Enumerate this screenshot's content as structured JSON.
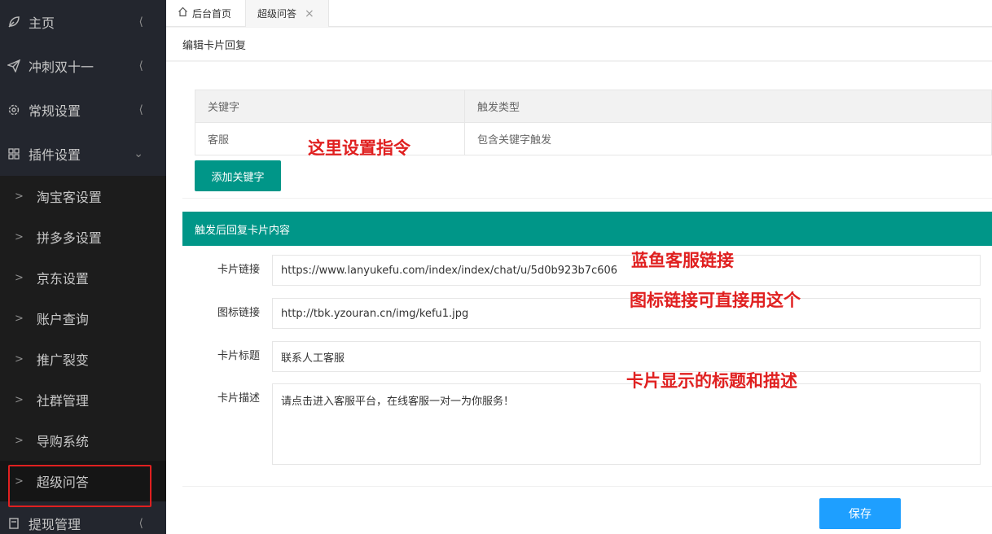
{
  "sidebar": {
    "items": [
      {
        "label": "主页",
        "icon": "leaf-icon"
      },
      {
        "label": "冲刺双十一",
        "icon": "paper-plane-icon"
      },
      {
        "label": "常规设置",
        "icon": "gear-icon"
      },
      {
        "label": "插件设置",
        "icon": "grid-icon"
      }
    ],
    "sub_items": [
      {
        "label": "淘宝客设置"
      },
      {
        "label": "拼多多设置"
      },
      {
        "label": "京东设置"
      },
      {
        "label": "账户查询"
      },
      {
        "label": "推广裂变"
      },
      {
        "label": "社群管理"
      },
      {
        "label": "导购系统"
      },
      {
        "label": "超级问答"
      }
    ],
    "bottom_item": {
      "label": "提现管理",
      "icon": "wallet-icon"
    }
  },
  "tabs": {
    "home": "后台首页",
    "current": "超级问答",
    "close": "×"
  },
  "page": {
    "title": "编辑卡片回复"
  },
  "keywords": {
    "headers": [
      "关键字",
      "触发类型"
    ],
    "rows": [
      [
        "客服",
        "包含关键字触发"
      ]
    ],
    "add_button": "添加关键字"
  },
  "card": {
    "section_title": "触发后回复卡片内容",
    "link_label": "卡片链接",
    "link_value": "https://www.lanyukefu.com/index/index/chat/u/5d0b923b7c606",
    "icon_label": "图标链接",
    "icon_value": "http://tbk.yzouran.cn/img/kefu1.jpg",
    "title_label": "卡片标题",
    "title_value": "联系人工客服",
    "desc_label": "卡片描述",
    "desc_value": "请点击进入客服平台，在线客服一对一为你服务！"
  },
  "save_button": "保存",
  "annotations": {
    "a1": "这里设置指令",
    "a2": "蓝鱼客服链接",
    "a3": "图标链接可直接用这个",
    "a4": "卡片显示的标题和描述"
  },
  "colors": {
    "sidebar_bg": "#23262e",
    "teal": "#009688",
    "blue": "#1e9fff",
    "annotation_red": "#e02020"
  }
}
